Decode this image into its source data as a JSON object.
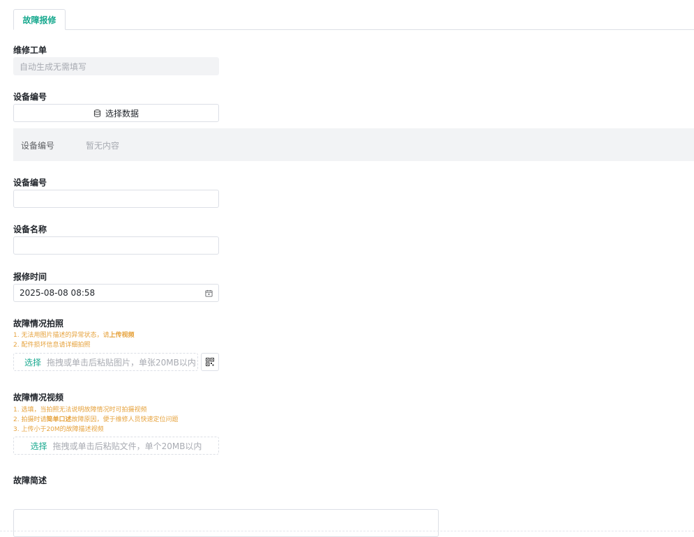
{
  "tabs": [
    {
      "label": "故障报修",
      "active": true
    }
  ],
  "accent_color": "#19a98f",
  "hint_color": "#e6a23c",
  "form": {
    "work_order": {
      "label": "维修工单",
      "placeholder": "自动生成无需填写"
    },
    "device_select": {
      "label": "设备编号",
      "button_label": "选择数据",
      "button_icon": "database-icon",
      "panel_key": "设备编号",
      "panel_value": "暂无内容"
    },
    "device_no": {
      "label": "设备编号",
      "value": ""
    },
    "device_name": {
      "label": "设备名称",
      "value": ""
    },
    "report_time": {
      "label": "报修时间",
      "value": "2025-08-08 08:58",
      "icon": "calendar-icon"
    },
    "photo": {
      "label": "故障情况拍照",
      "hint1_prefix": "1. 无法用图片描述的异常状态，请",
      "hint1_bold": "上传视频",
      "hint2": "2. 配件损坏信息请详细拍照",
      "pick": "选择",
      "drop_text": "拖拽或单击后粘贴图片，单张20MB以内",
      "side_icon": "qr-code-icon"
    },
    "video": {
      "label": "故障情况视频",
      "hint1": "1. 选填，当拍照无法说明故障情况时可拍摄视频",
      "hint2_prefix": "2. 拍摄时请",
      "hint2_bold": "简单口述",
      "hint2_suffix": "故障原因，便于维修人员快速定位问题",
      "hint3": "3. 上传小于20M的故障描述视频",
      "pick": "选择",
      "drop_text": "拖拽或单击后粘贴文件，单个20MB以内"
    },
    "description": {
      "label": "故障简述",
      "value": ""
    }
  }
}
